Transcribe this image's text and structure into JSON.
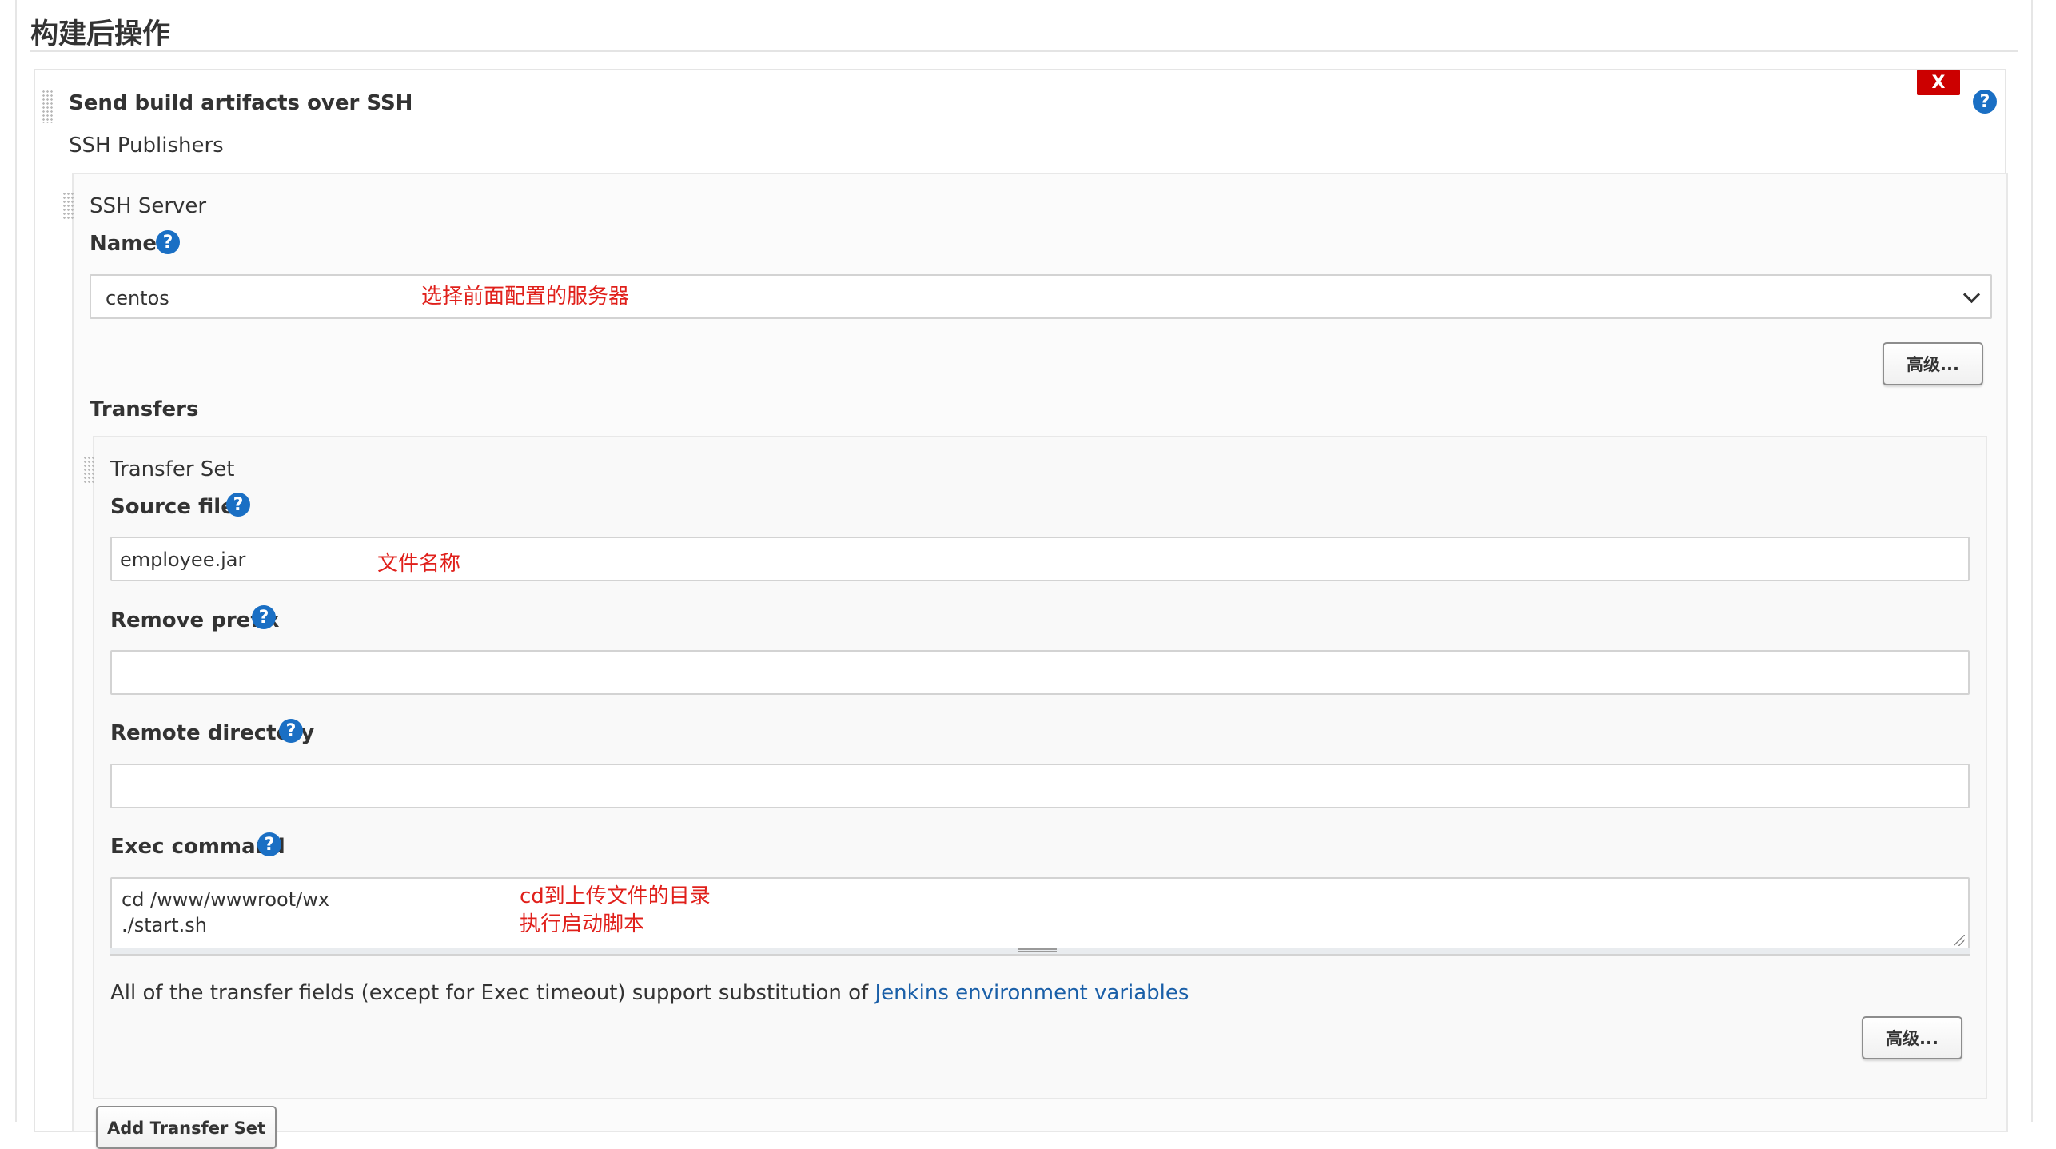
{
  "section": {
    "title": "构建后操作"
  },
  "publisher": {
    "title": "Send build artifacts over SSH",
    "delete_label": "X",
    "ssh_publishers_label": "SSH Publishers"
  },
  "ssh_server": {
    "heading": "SSH Server",
    "name_label": "Name",
    "name_value": "centos",
    "name_annotation": "选择前面配置的服务器",
    "advanced_label": "高级..."
  },
  "transfers": {
    "label": "Transfers",
    "transfer_set": {
      "heading": "Transfer Set",
      "source_files_label": "Source files",
      "source_files_value": "employee.jar",
      "source_files_annotation": "文件名称",
      "remove_prefix_label": "Remove prefix",
      "remove_prefix_value": "",
      "remote_directory_label": "Remote directory",
      "remote_directory_value": "",
      "exec_command_label": "Exec command",
      "exec_command_lines": [
        "cd /www/wwwroot/wx",
        "./start.sh"
      ],
      "exec_command_annotation_lines": [
        "cd到上传文件的目录",
        "执行启动脚本"
      ],
      "info_text": "All of the transfer fields (except for Exec timeout) support substitution of ",
      "info_link": "Jenkins environment variables",
      "advanced_label": "高级..."
    },
    "add_transfer_set_label": "Add Transfer Set"
  },
  "help_icon_glyph": "?",
  "colors": {
    "help_icon": "#1a6fc4",
    "delete_button": "#cc0000",
    "annotation": "#e0201b",
    "link": "#1a5fa8"
  }
}
